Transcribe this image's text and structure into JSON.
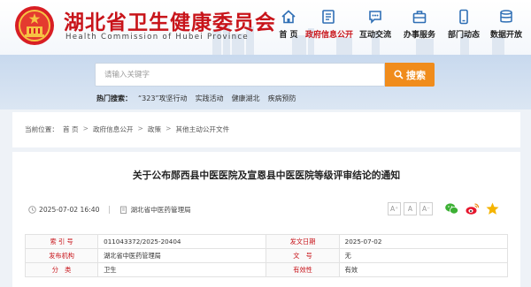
{
  "header": {
    "title": "湖北省卫生健康委员会",
    "subtitle": "Health Commission of Hubei Province"
  },
  "nav": [
    {
      "label": "首 页",
      "icon": "home-icon",
      "active": false
    },
    {
      "label": "政府信息公开",
      "icon": "document-icon",
      "active": true
    },
    {
      "label": "互动交流",
      "icon": "chat-icon",
      "active": false
    },
    {
      "label": "办事服务",
      "icon": "briefcase-icon",
      "active": false
    },
    {
      "label": "部门动态",
      "icon": "phone-icon",
      "active": false
    },
    {
      "label": "数据开放",
      "icon": "database-icon",
      "active": false
    }
  ],
  "search": {
    "placeholder": "请输入关键字",
    "value": "",
    "button_label": "搜索"
  },
  "hot": {
    "label": "热门搜索：",
    "items": [
      "“323”攻坚行动",
      "实践活动",
      "健康湖北",
      "疾病预防"
    ]
  },
  "breadcrumb": {
    "prefix": "当前位置：",
    "items": [
      "首 页",
      "政府信息公开",
      "政策",
      "其他主动公开文件"
    ]
  },
  "article": {
    "title": "关于公布郧西县中医医院及宣恩县中医医院等级评审结论的通知",
    "date": "2025-07-02 16:40",
    "source": "湖北省中医药管理局",
    "font_sizes": [
      "A⁺",
      "A",
      "A⁻"
    ]
  },
  "info_table": {
    "rows": [
      [
        "索 引 号",
        "011043372/2025-20404",
        "发文日期",
        "2025-07-02"
      ],
      [
        "发布机构",
        "湖北省中医药管理局",
        "文　号",
        "无"
      ],
      [
        "分　类",
        "卫生",
        "有效性",
        "有效"
      ]
    ]
  },
  "colors": {
    "brand_red": "#c8141a",
    "search_orange": "#f08c1c",
    "band_blue": "#c8d9ee"
  }
}
